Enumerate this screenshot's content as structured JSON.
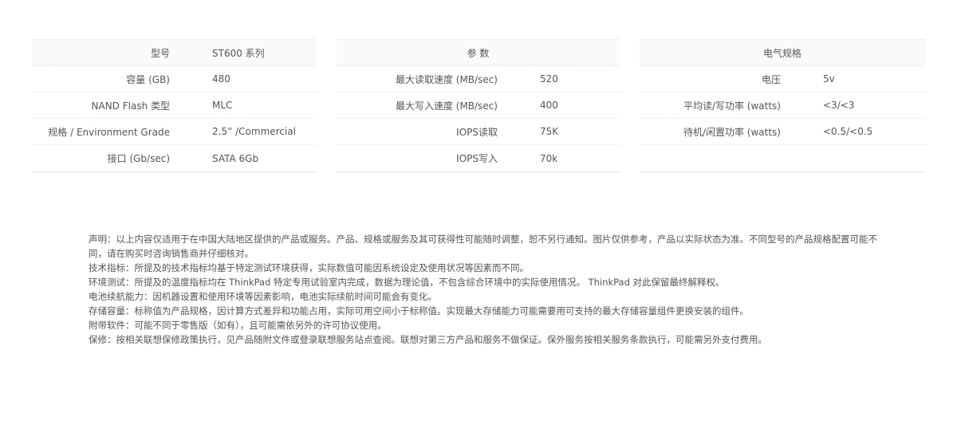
{
  "tables": [
    {
      "header": {
        "label": "型号",
        "value": "ST600 系列"
      },
      "rows": [
        {
          "label": "容量 (GB)",
          "value": "480"
        },
        {
          "label": "NAND Flash 类型",
          "value": "MLC"
        },
        {
          "label": "规格 / Environment Grade",
          "value": "2.5”  /Commercial"
        },
        {
          "label": "接口 (Gb/sec)",
          "value": "SATA 6Gb"
        }
      ]
    },
    {
      "header": {
        "title": "参 数"
      },
      "rows": [
        {
          "label": "最大读取速度 (MB/sec)",
          "value": "520"
        },
        {
          "label": "最大写入速度 (MB/sec)",
          "value": "400"
        },
        {
          "label": "IOPS读取",
          "value": "75K"
        },
        {
          "label": "IOPS写入",
          "value": "70k"
        }
      ]
    },
    {
      "header": {
        "title": "电气规格"
      },
      "rows": [
        {
          "label": "电压",
          "value": "5v"
        },
        {
          "label": "平均读/写功率 (watts)",
          "value": "<3/<3"
        },
        {
          "label": "待机/闲置功率 (watts)",
          "value": "<0.5/<0.5"
        }
      ]
    }
  ],
  "notes": [
    "声明：以上内容仅适用于在中国大陆地区提供的产品或服务。产品、规格或服务及其可获得性可能随时调整，恕不另行通知。图片仅供参考，产品以实际状态为准。不同型号的产品规格配置可能不同，请在购买时咨询销售商并仔细核对。",
    "技术指标：所提及的技术指标均基于特定测试环境获得，实际数值可能因系统设定及使用状况等因素而不同。",
    "环境测试：所提及的温度指标均在 ThinkPad 特定专用试验室内完成，数据为理论值，不包含综合环境中的实际使用情况。 ThinkPad 对此保留最终解释权。",
    "电池续航能力：因机器设置和使用环境等因素影响，电池实际续航时间可能会有变化。",
    "存储容量：标称值为产品规格，因计算方式差异和功能占用，实际可用空间小于标称值。实现最大存储能力可能需要用可支持的最大存储容量组件更换安装的组件。",
    "附带软件：可能不同于零售版（如有），且可能需依另外的许可协议使用。",
    "保修：按相关联想保修政策执行，见产品随附文件或登录联想服务站点查阅。联想对第三方产品和服务不做保证。保外服务按相关服务条款执行，可能需另外支付费用。"
  ]
}
